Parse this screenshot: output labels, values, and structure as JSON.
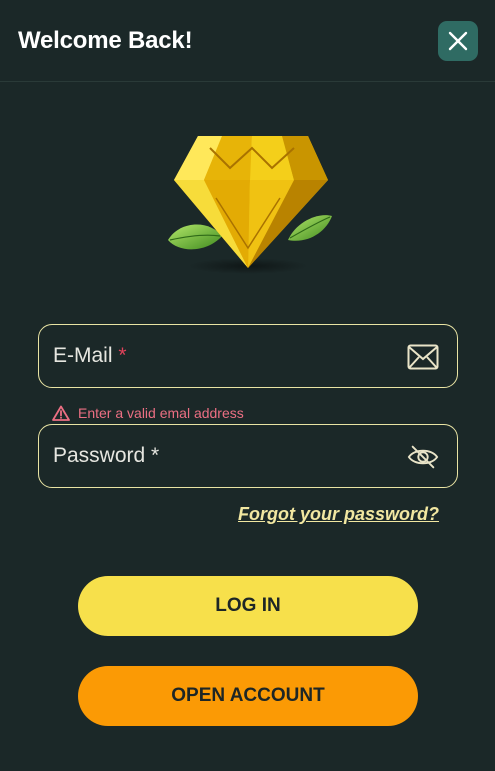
{
  "header": {
    "title": "Welcome Back!",
    "close_icon": "close-icon"
  },
  "logo": {
    "icon": "diamond-with-leaves-logo"
  },
  "email_field": {
    "label": "E-Mail",
    "required_marker": "*",
    "icon": "envelope-icon",
    "value": ""
  },
  "email_error": {
    "icon": "warning-triangle-icon",
    "text": "Enter a valid emal address"
  },
  "password_field": {
    "label": "Password",
    "required_marker": "*",
    "icon": "eye-slash-icon",
    "value": ""
  },
  "forgot_password": {
    "label": "Forgot your password?"
  },
  "buttons": {
    "login_label": "LOG IN",
    "open_account_label": "OPEN ACCOUNT"
  },
  "colors": {
    "background": "#1b2828",
    "field_border": "#e9e4a4",
    "error": "#ec6f83",
    "login_button": "#f7e04b",
    "open_account_button": "#fb9a05",
    "close_button": "#2f6b63"
  }
}
